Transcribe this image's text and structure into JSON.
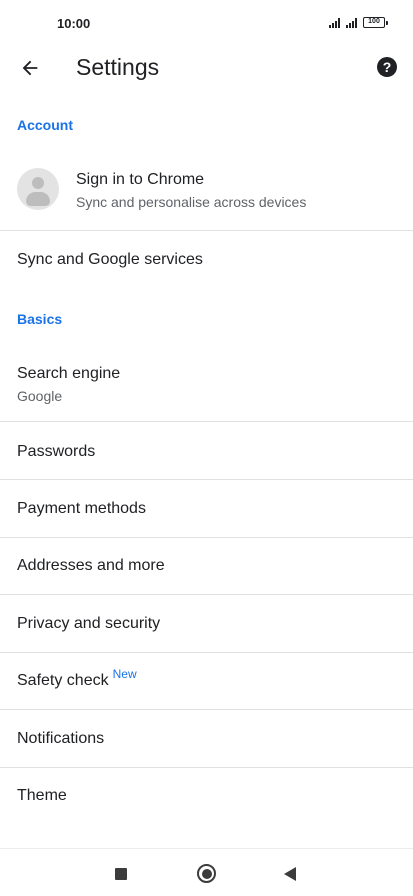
{
  "status_bar": {
    "time": "10:00",
    "battery": "100",
    "icons": [
      "signal-icon",
      "signal-icon",
      "battery-icon"
    ]
  },
  "toolbar": {
    "title": "Settings",
    "back_icon": "arrow-back-icon",
    "help_icon": "help-icon",
    "help_glyph": "?"
  },
  "sections": {
    "account": "Account",
    "basics": "Basics"
  },
  "account": {
    "title": "Sign in to Chrome",
    "subtitle": "Sync and personalise across devices",
    "avatar_icon": "person-avatar-icon"
  },
  "items": {
    "sync": "Sync and Google services",
    "search_engine": {
      "title": "Search engine",
      "value": "Google"
    },
    "passwords": "Passwords",
    "payment_methods": "Payment methods",
    "addresses": "Addresses and more",
    "privacy": "Privacy and security",
    "safety_check": {
      "title": "Safety check",
      "badge": "New"
    },
    "notifications": "Notifications",
    "theme": "Theme"
  },
  "nav_bar": {
    "icons": [
      "recents-square-icon",
      "home-circle-icon",
      "back-triangle-icon"
    ]
  },
  "colors": {
    "accent": "#1a73e8",
    "text_primary": "#202124",
    "text_secondary": "#5f6368",
    "divider": "#e0e0e0"
  }
}
